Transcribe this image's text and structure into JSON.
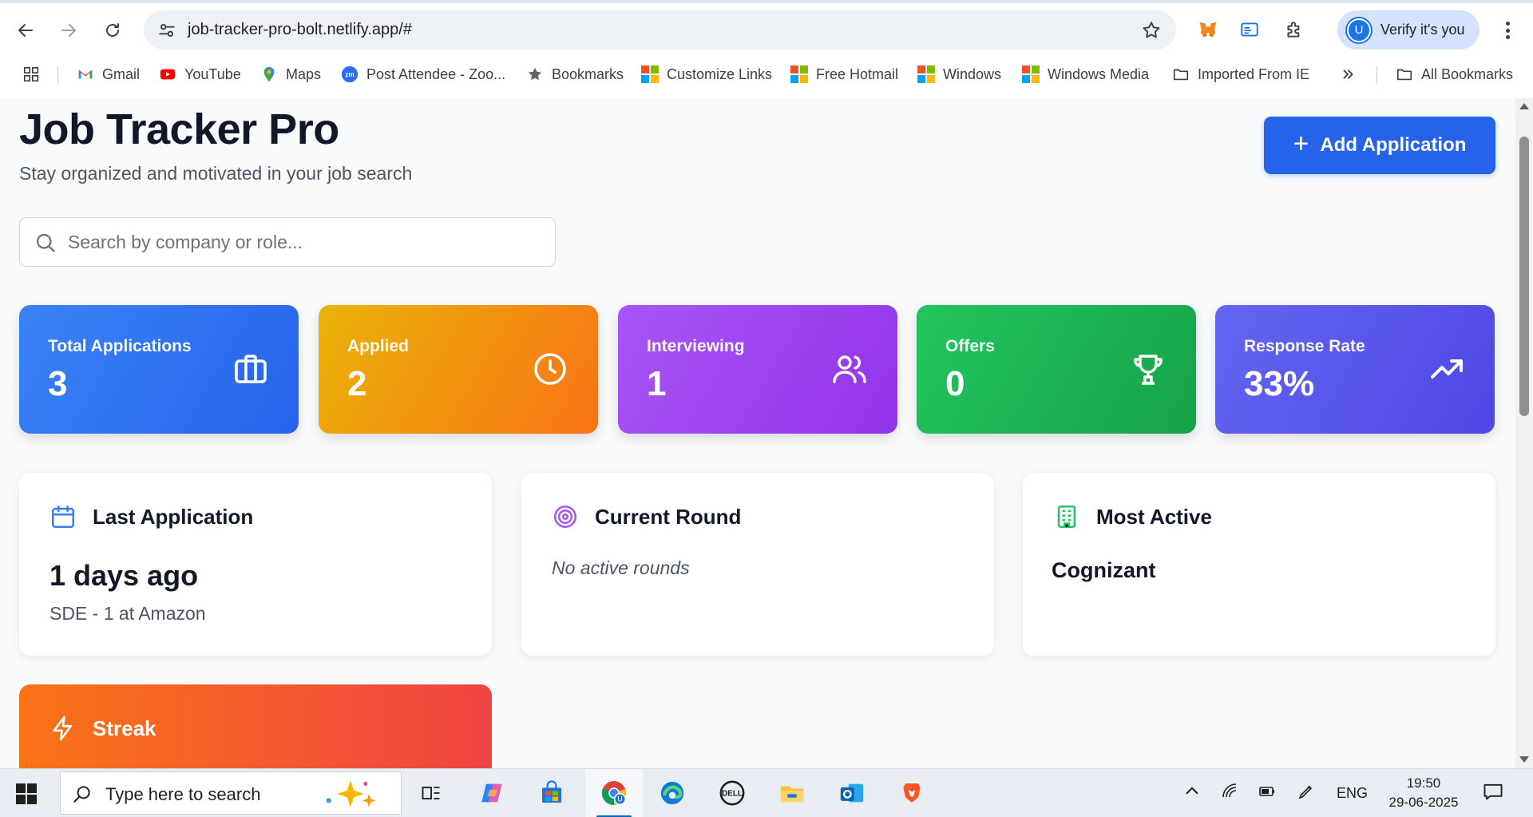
{
  "browser": {
    "url": "job-tracker-pro-bolt.netlify.app/#",
    "profile_initial": "U",
    "verify_label": "Verify it's you",
    "bookmarks": [
      {
        "label": "Gmail",
        "icon": "gmail-icon"
      },
      {
        "label": "YouTube",
        "icon": "youtube-icon"
      },
      {
        "label": "Maps",
        "icon": "maps-icon"
      },
      {
        "label": "Post Attendee - Zoo...",
        "icon": "zoom-icon"
      },
      {
        "label": "Bookmarks",
        "icon": "star-icon"
      },
      {
        "label": "Customize Links",
        "icon": "microsoft-icon"
      },
      {
        "label": "Free Hotmail",
        "icon": "microsoft-icon"
      },
      {
        "label": "Windows",
        "icon": "microsoft-icon"
      },
      {
        "label": "Windows Media",
        "icon": "microsoft-icon"
      },
      {
        "label": "Imported From IE",
        "icon": "folder-icon"
      },
      {
        "label": "All Bookmarks",
        "icon": "folder-icon"
      }
    ]
  },
  "app": {
    "title": "Job Tracker Pro",
    "subtitle": "Stay organized and motivated in your job search",
    "add_button": "Add Application",
    "search_placeholder": "Search by company or role..."
  },
  "stats": [
    {
      "label": "Total Applications",
      "value": "3",
      "icon": "briefcase-icon",
      "colors": [
        "#3b82f6",
        "#2563eb"
      ]
    },
    {
      "label": "Applied",
      "value": "2",
      "icon": "clock-icon",
      "colors": [
        "#eab308",
        "#f97316"
      ]
    },
    {
      "label": "Interviewing",
      "value": "1",
      "icon": "users-icon",
      "colors": [
        "#a855f7",
        "#9333ea"
      ]
    },
    {
      "label": "Offers",
      "value": "0",
      "icon": "trophy-icon",
      "colors": [
        "#22c55e",
        "#16a34a"
      ]
    },
    {
      "label": "Response Rate",
      "value": "33%",
      "icon": "trending-up-icon",
      "colors": [
        "#6366f1",
        "#4f46e5"
      ]
    }
  ],
  "cards": {
    "last_application": {
      "title": "Last Application",
      "value": "1 days ago",
      "detail": "SDE - 1 at Amazon",
      "accent": "#3b82f6"
    },
    "current_round": {
      "title": "Current Round",
      "value": "No active rounds",
      "accent": "#a855f7"
    },
    "most_active": {
      "title": "Most Active",
      "value": "Cognizant",
      "accent": "#22c55e"
    },
    "streak": {
      "title": "Streak"
    }
  },
  "taskbar": {
    "search_text": "Type here to search",
    "language": "ENG",
    "time": "19:50",
    "date": "29-06-2025"
  }
}
